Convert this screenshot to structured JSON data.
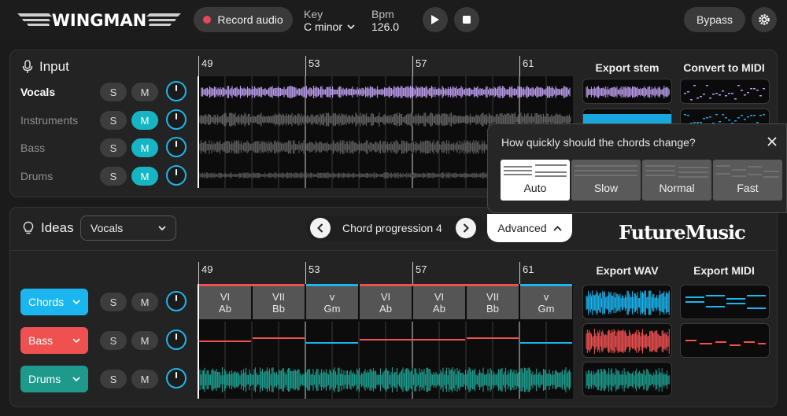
{
  "app": {
    "logo_text": "WINGMAN",
    "record_label": "Record audio",
    "key_label": "Key",
    "key_value": "C minor",
    "bpm_label": "Bpm",
    "bpm_value": "126.0",
    "bypass_label": "Bypass",
    "brand_text": "FutureMusic"
  },
  "input": {
    "title": "Input",
    "tracks": [
      {
        "label": "Vocals",
        "s": "S",
        "m": "M",
        "muted": false,
        "active": true
      },
      {
        "label": "Instruments",
        "s": "S",
        "m": "M",
        "muted": true,
        "active": false
      },
      {
        "label": "Bass",
        "s": "S",
        "m": "M",
        "muted": true,
        "active": false
      },
      {
        "label": "Drums",
        "s": "S",
        "m": "M",
        "muted": true,
        "active": false
      }
    ],
    "ruler": [
      "49",
      "53",
      "57",
      "61"
    ],
    "export_stem_label": "Export stem",
    "convert_midi_label": "Convert to MIDI"
  },
  "popup": {
    "question": "How quickly should the chords change?",
    "options": [
      "Auto",
      "Slow",
      "Normal",
      "Fast"
    ],
    "selected": "Auto"
  },
  "ideas": {
    "title": "Ideas",
    "source_selected": "Vocals",
    "progression_label": "Chord progression 4",
    "advanced_label": "Advanced",
    "ruler": [
      "49",
      "53",
      "57",
      "61"
    ],
    "export_wav_label": "Export WAV",
    "export_midi_label": "Export MIDI",
    "tracks": [
      {
        "label": "Chords",
        "s": "S",
        "m": "M",
        "color": "#1bb6f0"
      },
      {
        "label": "Bass",
        "s": "S",
        "m": "M",
        "color": "#ef5150"
      },
      {
        "label": "Drums",
        "s": "S",
        "m": "M",
        "color": "#1e9a8c"
      }
    ],
    "chords": [
      {
        "roman": "VI",
        "name": "Ab"
      },
      {
        "roman": "VII",
        "name": "Bb"
      },
      {
        "roman": "v",
        "name": "Gm"
      },
      {
        "roman": "VI",
        "name": "Ab"
      },
      {
        "roman": "VI",
        "name": "Ab"
      },
      {
        "roman": "VII",
        "name": "Bb"
      },
      {
        "roman": "v",
        "name": "Gm"
      }
    ]
  },
  "colors": {
    "vocals_wave": "#b79ae8",
    "teal": "#17b5c4",
    "knob": "#1fb4e8",
    "chords": "#1bb6f0",
    "bass": "#ef5150",
    "drums": "#1e9a8c"
  }
}
